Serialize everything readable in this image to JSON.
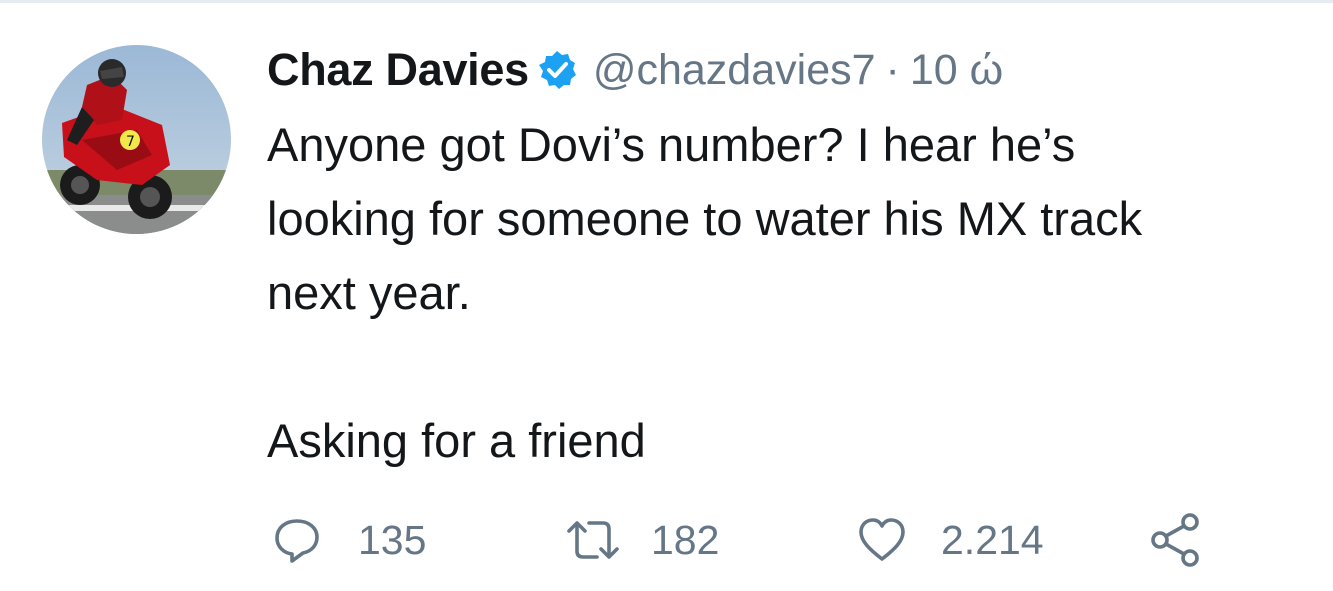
{
  "tweet": {
    "display_name": "Chaz Davies",
    "handle": "@chazdavies7",
    "separator": "·",
    "time": "10 ώ",
    "text_lines": [
      "Anyone got Dovi’s number? I hear he’s",
      "looking for someone to water his MX track",
      "next year.",
      "",
      "Asking for a friend"
    ],
    "verified": true
  },
  "actions": {
    "reply": {
      "icon": "reply-icon",
      "count": "135"
    },
    "retweet": {
      "icon": "retweet-icon",
      "count": "182"
    },
    "like": {
      "icon": "heart-icon",
      "count": "2.214"
    },
    "share": {
      "icon": "share-icon"
    }
  },
  "colors": {
    "text": "#14171a",
    "secondary": "#657786",
    "verified_badge": "#1da1f2",
    "divider": "#e6ecf0"
  }
}
